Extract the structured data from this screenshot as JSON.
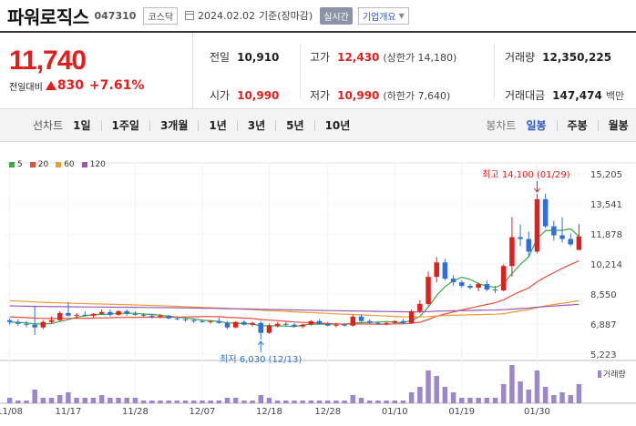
{
  "header": {
    "stock_name": "파워로직스",
    "stock_code": "047310",
    "market_badge": "코스닥",
    "date": "2024.02.02",
    "basis": "기준(장마감)",
    "realtime_label": "실시간",
    "company_info_label": "기업개요"
  },
  "price": {
    "current": "11,740",
    "change_label": "전일대비",
    "change_value": "830",
    "change_percent": "+7.61%",
    "up_color": "#e0201d"
  },
  "stats": {
    "prev_close_label": "전일",
    "prev_close": "10,910",
    "high_label": "고가",
    "high": "12,430",
    "upper_limit": "(상한가 14,180)",
    "volume_label": "거래량",
    "volume": "12,350,225",
    "open_label": "시가",
    "open": "10,990",
    "low_label": "저가",
    "low": "10,990",
    "lower_limit": "(하한가 7,640)",
    "amount_label": "거래대금",
    "amount": "147,474",
    "amount_unit": "백만"
  },
  "tabs": {
    "line_chart_label": "선차트",
    "periods": [
      "1일",
      "1주일",
      "3개월",
      "1년",
      "3년",
      "5년",
      "10년"
    ],
    "candle_label": "봉차트",
    "candle_periods": [
      "일봉",
      "주봉",
      "월봉"
    ],
    "active_candle": "일봉"
  },
  "chart_data": {
    "type": "candlestick",
    "legend": [
      {
        "name": "5",
        "color": "#3aa845"
      },
      {
        "name": "20",
        "color": "#e84c3d"
      },
      {
        "name": "60",
        "color": "#f39b2f"
      },
      {
        "name": "120",
        "color": "#9b59b6"
      }
    ],
    "y_ticks": [
      "15,205",
      "13,541",
      "11,878",
      "10,214",
      "8,550",
      "6,887",
      "5,223"
    ],
    "ylim": [
      5223,
      15205
    ],
    "x_ticks": [
      "11/08",
      "11/17",
      "11/28",
      "12/07",
      "12/18",
      "12/28",
      "01/10",
      "01/19",
      "01/30"
    ],
    "high_annotation": "최고 14,100 (01/29)",
    "low_annotation": "최저 6,030 (12/13)",
    "volume_label": "거래량",
    "up_color": "#e0201d",
    "down_color": "#2f6fd6",
    "candles": [
      [
        7100,
        7200,
        6850,
        7000
      ],
      [
        7000,
        7150,
        6800,
        6900
      ],
      [
        6900,
        7050,
        6700,
        6850
      ],
      [
        6850,
        7900,
        6300,
        6700
      ],
      [
        6700,
        7100,
        6600,
        7000
      ],
      [
        7000,
        7300,
        6900,
        7100
      ],
      [
        7100,
        7600,
        7050,
        7500
      ],
      [
        7500,
        8100,
        7300,
        7350
      ],
      [
        7350,
        7500,
        7200,
        7400
      ],
      [
        7400,
        7600,
        7300,
        7350
      ],
      [
        7350,
        7500,
        7250,
        7450
      ],
      [
        7450,
        7700,
        7400,
        7550
      ],
      [
        7550,
        7700,
        7300,
        7400
      ],
      [
        7400,
        7650,
        7350,
        7600
      ],
      [
        7600,
        7700,
        7350,
        7450
      ],
      [
        7450,
        7600,
        7350,
        7400
      ],
      [
        7400,
        7500,
        7250,
        7350
      ],
      [
        7350,
        7450,
        7200,
        7300
      ],
      [
        7300,
        7450,
        7200,
        7350
      ],
      [
        7350,
        7400,
        7150,
        7200
      ],
      [
        7200,
        7300,
        7100,
        7150
      ],
      [
        7150,
        7250,
        7000,
        7100
      ],
      [
        7100,
        7200,
        6950,
        7050
      ],
      [
        7050,
        7150,
        6950,
        7000
      ],
      [
        7000,
        7100,
        6900,
        7050
      ],
      [
        7050,
        7250,
        6900,
        6950
      ],
      [
        6950,
        7050,
        6600,
        6700
      ],
      [
        6700,
        7050,
        6650,
        7000
      ],
      [
        7000,
        7100,
        6800,
        6850
      ],
      [
        6850,
        7000,
        6750,
        6950
      ],
      [
        6950,
        7050,
        6030,
        6400
      ],
      [
        6400,
        6900,
        6350,
        6800
      ],
      [
        6800,
        7000,
        6700,
        6900
      ],
      [
        6900,
        7000,
        6800,
        6850
      ],
      [
        6850,
        6950,
        6700,
        6750
      ],
      [
        6750,
        6900,
        6650,
        6850
      ],
      [
        6850,
        7100,
        6800,
        7050
      ],
      [
        7050,
        7150,
        6850,
        6900
      ],
      [
        6900,
        7000,
        6750,
        6800
      ],
      [
        6800,
        6950,
        6700,
        6850
      ],
      [
        6850,
        6950,
        6750,
        6800
      ],
      [
        6800,
        7400,
        6750,
        7300
      ],
      [
        7300,
        7400,
        7000,
        7050
      ],
      [
        7050,
        7150,
        6900,
        6950
      ],
      [
        6950,
        7050,
        6850,
        6900
      ],
      [
        6900,
        7000,
        6800,
        6950
      ],
      [
        6950,
        7100,
        6900,
        7050
      ],
      [
        7050,
        7150,
        6900,
        6950
      ],
      [
        6950,
        7700,
        6900,
        7600
      ],
      [
        7600,
        8200,
        7500,
        8000
      ],
      [
        8000,
        9800,
        7900,
        9500
      ],
      [
        9500,
        10600,
        9200,
        10300
      ],
      [
        10300,
        10500,
        9300,
        9400
      ],
      [
        9400,
        9600,
        9000,
        9200
      ],
      [
        9200,
        9300,
        8900,
        9000
      ],
      [
        9000,
        9100,
        8800,
        8900
      ],
      [
        8900,
        9200,
        8700,
        9100
      ],
      [
        9100,
        9300,
        8700,
        8800
      ],
      [
        8800,
        9000,
        8600,
        8750
      ],
      [
        8750,
        10200,
        8700,
        10100
      ],
      [
        10100,
        12800,
        9500,
        11700
      ],
      [
        11700,
        12400,
        11200,
        11600
      ],
      [
        11600,
        12000,
        10600,
        10900
      ],
      [
        10900,
        14100,
        10800,
        13800
      ],
      [
        13800,
        14100,
        12200,
        12300
      ],
      [
        12300,
        12600,
        11500,
        11800
      ],
      [
        11800,
        12800,
        11400,
        11600
      ],
      [
        11600,
        11900,
        11200,
        11300
      ],
      [
        10990,
        12430,
        10990,
        11740
      ]
    ],
    "volumes": [
      2,
      1,
      1,
      5,
      2,
      2,
      3,
      4,
      2,
      2,
      2,
      3,
      2,
      2,
      2,
      2,
      1,
      1,
      1,
      1,
      1,
      1,
      1,
      1,
      1,
      1,
      2,
      2,
      1,
      1,
      3,
      2,
      1,
      1,
      1,
      1,
      1,
      1,
      1,
      1,
      1,
      3,
      2,
      1,
      1,
      1,
      1,
      1,
      4,
      6,
      12,
      10,
      6,
      4,
      2,
      2,
      2,
      2,
      2,
      7,
      14,
      8,
      5,
      12,
      6,
      3,
      4,
      3,
      7
    ]
  }
}
